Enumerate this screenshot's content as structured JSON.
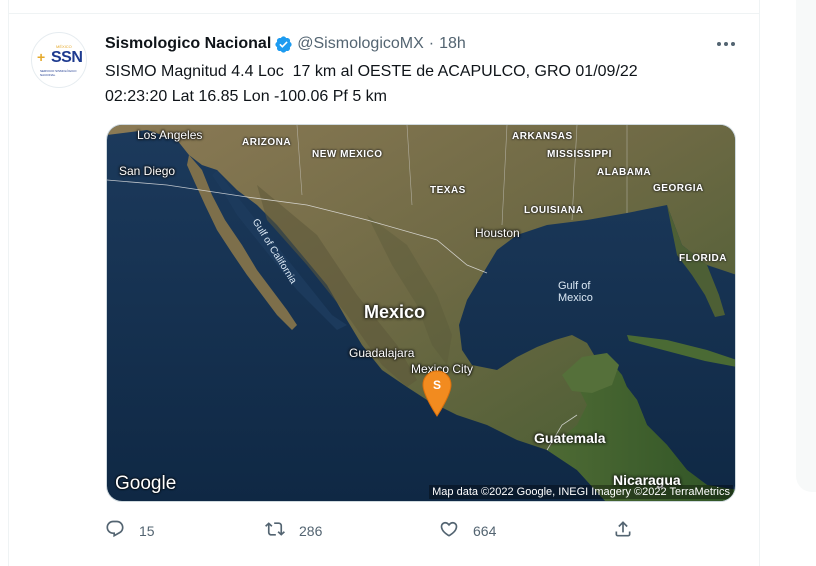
{
  "tweet": {
    "display_name": "Sismologico Nacional",
    "handle": "@SismologicoMX",
    "separator": "·",
    "time": "18h",
    "text": "SISMO Magnitud 4.4 Loc  17 km al OESTE de ACAPULCO, GRO 01/09/22\n02:23:20 Lat 16.85 Lon -100.06 Pf 5 km",
    "avatar": {
      "top_text": "MÉXICO",
      "logo_text": "SSN",
      "sub_text": "SERVICIO SISMOLÓGICO NACIONAL"
    },
    "verified_icon": "verified-badge-icon",
    "more_icon": "more-options-icon"
  },
  "map": {
    "labels": {
      "los_angeles": "Los Angeles",
      "san_diego": "San Diego",
      "arizona": "ARIZONA",
      "new_mexico": "NEW MEXICO",
      "texas": "TEXAS",
      "arkansas": "ARKANSAS",
      "mississippi": "MISSISSIPPI",
      "alabama": "ALABAMA",
      "georgia": "GEORGIA",
      "louisiana": "LOUISIANA",
      "houston": "Houston",
      "florida": "FLORIDA",
      "gulf_of_california": "Gulf of California",
      "gulf_of_mexico_1": "Gulf of",
      "gulf_of_mexico_2": "Mexico",
      "mexico": "Mexico",
      "guadalajara": "Guadalajara",
      "mexico_city": "Mexico City",
      "guatemala": "Guatemala",
      "nicaragua": "Nicaragua"
    },
    "pin_letter": "S",
    "google_logo": "Google",
    "attribution": "Map data ©2022 Google, INEGI Imagery ©2022 TerraMetrics"
  },
  "actions": {
    "reply": {
      "icon": "reply-icon",
      "count": "15"
    },
    "retweet": {
      "icon": "retweet-icon",
      "count": "286"
    },
    "like": {
      "icon": "heart-icon",
      "count": "664"
    },
    "share": {
      "icon": "share-icon"
    }
  },
  "colors": {
    "text_primary": "#0f1419",
    "text_secondary": "#536471",
    "verified_blue": "#1d9bf0",
    "pin_orange": "#f28b1f",
    "ocean": "#14304f"
  }
}
